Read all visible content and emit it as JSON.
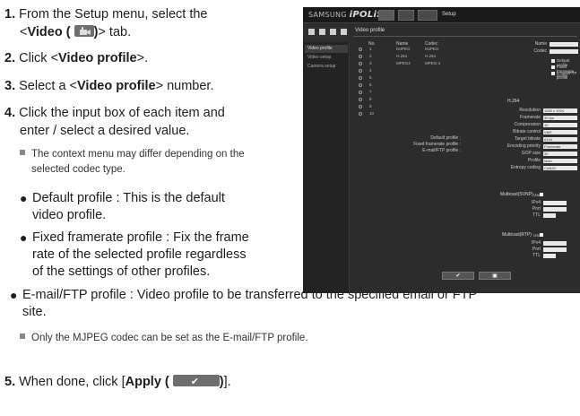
{
  "steps": [
    {
      "num": "1.",
      "pre": "From the Setup menu, select the",
      "line2_pre": "<",
      "bold": "Video (",
      "icon": "video-icon",
      "bold_close": ")",
      "post": "> tab."
    },
    {
      "num": "2.",
      "pre": "Click <",
      "bold": "Video profile",
      "post": ">."
    },
    {
      "num": "3.",
      "pre": "Select a <",
      "bold": "Video profile",
      "post": "> number."
    },
    {
      "num": "4.",
      "line1": "Click the input box of each item and",
      "line2": "enter / select a desired value."
    }
  ],
  "note1": {
    "line1": "The context menu may differ depending on the",
    "line2": "selected codec type."
  },
  "bullets": [
    {
      "line1": "Default profile : This is the default",
      "line2": "video profile."
    },
    {
      "line1": "Fixed framerate profile : Fix the frame",
      "line2": "rate of the selected profile regardless",
      "line3": "of the settings of other profiles."
    },
    {
      "line1": "E-mail/FTP profile : Video profile to be transferred to the specified email or FTP",
      "line2": "site."
    }
  ],
  "note2": "Only the MJPEG codec can be set as the E-mail/FTP profile.",
  "step5": {
    "num": "5.",
    "pre": "When done, click [",
    "bold": "Apply (",
    "icon": "check-icon",
    "bold_close": ")",
    "post": "]."
  },
  "screenshot": {
    "brand": "SAMSUNG",
    "brand2": "iPOLiS",
    "setup": "Setup",
    "nav": [
      "Video profile",
      "Video setup",
      "Camera setup"
    ],
    "title": "Video profile",
    "cols": [
      "No.",
      "Name",
      "Codec"
    ],
    "rows": [
      {
        "no": "1",
        "name": "MJPEG",
        "codec": "MJPEG"
      },
      {
        "no": "2",
        "name": "H.264",
        "codec": "H.264"
      },
      {
        "no": "3",
        "name": "MPEG4",
        "codec": "MPEG-4"
      },
      {
        "no": "4",
        "name": "",
        "codec": ""
      },
      {
        "no": "5",
        "name": "",
        "codec": ""
      },
      {
        "no": "6",
        "name": "",
        "codec": ""
      },
      {
        "no": "7",
        "name": "",
        "codec": ""
      },
      {
        "no": "8",
        "name": "",
        "codec": ""
      },
      {
        "no": "9",
        "name": "",
        "codec": ""
      },
      {
        "no": "10",
        "name": "",
        "codec": ""
      }
    ],
    "profile_labels": [
      "Default profile :",
      "Fixed framerate profile :",
      "E-mail/FTP profile :"
    ],
    "name_label": "Name",
    "codec_label": "Codec",
    "checks": [
      "Default profile",
      "Fixed framerate profile",
      "E-mail/FTP profile"
    ],
    "codec_section": "H.264",
    "settings": [
      "Resolution",
      "Framerate",
      "Compression",
      "Bitrate control",
      "Target bitrate",
      "Encoding priority",
      "GOP size",
      "Profile",
      "Entropy coding"
    ],
    "setting_values": [
      "1280 x 1024",
      "30 fps",
      "10",
      "VBR",
      "6144",
      "Framerate",
      "30",
      "Main",
      "CABAC"
    ],
    "mc_svnp": "Multicast(SVNP)",
    "mc_rtp": "Multicast(RTP)",
    "use": "Use",
    "ip_labels": [
      "IPv4",
      "Port",
      "TTL"
    ]
  }
}
